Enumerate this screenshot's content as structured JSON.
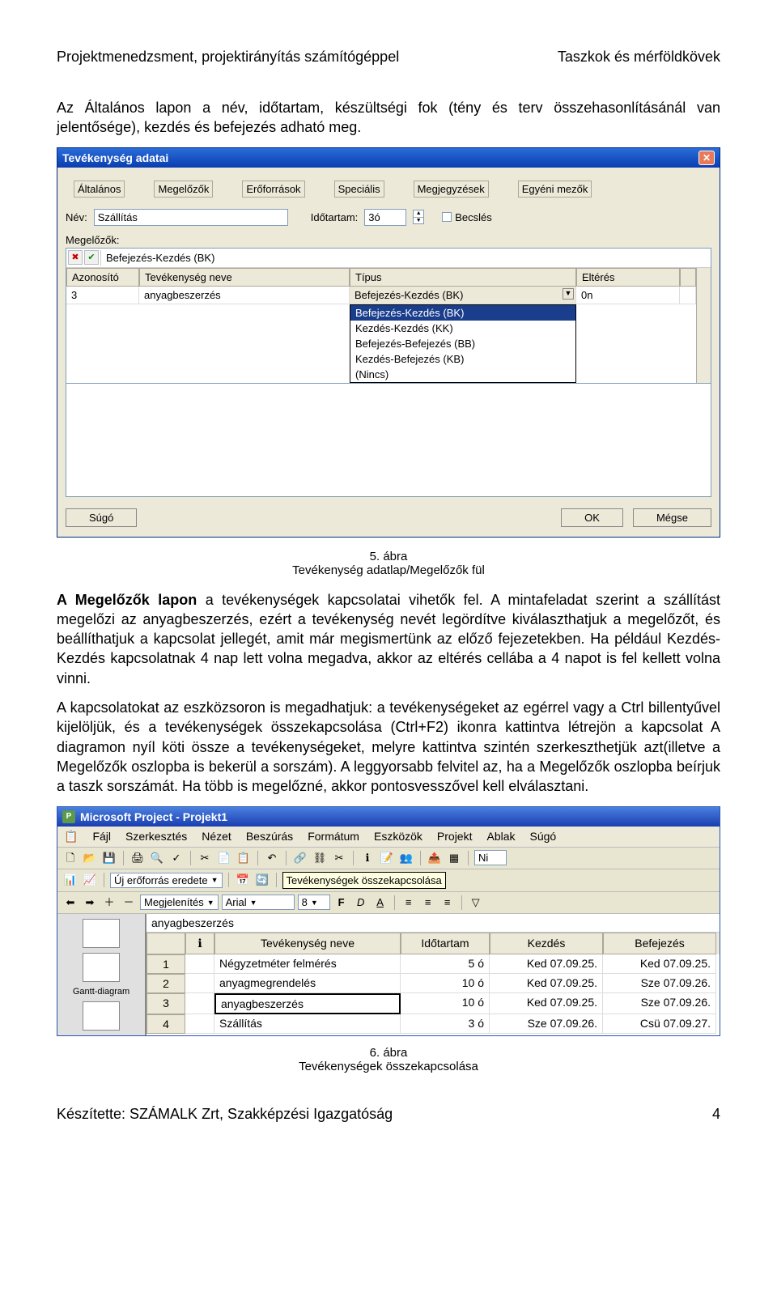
{
  "doc": {
    "header_left": "Projektmenedzsment, projektirányítás számítógéppel",
    "header_right": "Taszkok és mérföldkövek",
    "p1": "Az Általános lapon a név, időtartam, készültségi fok (tény és terv összehasonlításánál van jelentősége), kezdés és befejezés adható meg.",
    "fig5_caption_a": "5. ábra",
    "fig5_caption_b": "Tevékenység adatlap/Megelőzők fül",
    "p2": "A Megelőzők lapon a tevékenységek kapcsolatai vihetők fel. A mintafeladat szerint a szállítást megelőzi az anyagbeszerzés, ezért a tevékenység nevét legördítve kiválaszthatjuk a megelőzőt, és beállíthatjuk a kapcsolat jellegét, amit már megismertünk az előző fejezetekben. Ha például Kezdés-Kezdés kapcsolatnak 4 nap lett volna megadva, akkor az eltérés cellába a 4 napot is fel kellett volna vinni.",
    "p3": "A kapcsolatokat az eszközsoron is megadhatjuk: a tevékenységeket az egérrel vagy a Ctrl billentyűvel kijelöljük, és a tevékenységek összekapcsolása (Ctrl+F2) ikonra kattintva létrejön a kapcsolat A diagramon nyíl köti össze a tevékenységeket, melyre kattintva szintén szerkeszthetjük azt(illetve a Megelőzők oszlopba is bekerül a sorszám). A leggyorsabb felvitel az, ha a Megelőzők oszlopba beírjuk a taszk sorszámát. Ha több is megelőzné, akkor pontosvesszővel kell elválasztani.",
    "fig6_caption_a": "6. ábra",
    "fig6_caption_b": "Tevékenységek összekapcsolása",
    "footer_left": "Készítette: SZÁMALK Zrt, Szakképzési Igazgatóság",
    "footer_right": "4"
  },
  "dialog": {
    "title": "Tevékenység adatai",
    "tabs": [
      "Általános",
      "Megelőzők",
      "Erőforrások",
      "Speciális",
      "Megjegyzések",
      "Egyéni mezők"
    ],
    "lbl_name": "Név:",
    "name": "Szállítás",
    "lbl_dur": "Időtartam:",
    "dur": "3ó",
    "lbl_est": "Becslés",
    "lbl_pred": "Megelőzők:",
    "edit_value": "Befejezés-Kezdés (BK)",
    "headers": [
      "Azonosító",
      "Tevékenység neve",
      "Típus",
      "Eltérés"
    ],
    "row": {
      "id": "3",
      "name": "anyagbeszerzés",
      "type": "Befejezés-Kezdés (BK)",
      "lag": "0n"
    },
    "dd_options": [
      "Befejezés-Kezdés (BK)",
      "Kezdés-Kezdés (KK)",
      "Befejezés-Befejezés (BB)",
      "Kezdés-Befejezés (KB)",
      "(Nincs)"
    ],
    "btn_help": "Súgó",
    "btn_ok": "OK",
    "btn_cancel": "Mégse"
  },
  "app": {
    "title": "Microsoft Project - Projekt1",
    "menu": [
      "Fájl",
      "Szerkesztés",
      "Nézet",
      "Beszúrás",
      "Formátum",
      "Eszközök",
      "Projekt",
      "Ablak",
      "Súgó"
    ],
    "tb_newres": "Új erőforrás eredete",
    "tb_show": "Megjelenítés",
    "tb_font": "Arial",
    "tb_size": "8",
    "tooltip": "Tevékenységek összekapcsolása",
    "edit_value": "anyagbeszerzés",
    "side_label": "Gantt-diagram",
    "sheet_headers": [
      "",
      "",
      "Tevékenység neve",
      "Időtartam",
      "Kezdés",
      "Befejezés"
    ],
    "info_icon": "ℹ",
    "rows": [
      {
        "n": "1",
        "name": "Négyzetméter felmérés",
        "dur": "5 ó",
        "start": "Ked 07.09.25.",
        "end": "Ked 07.09.25."
      },
      {
        "n": "2",
        "name": "anyagmegrendelés",
        "dur": "10 ó",
        "start": "Ked 07.09.25.",
        "end": "Sze 07.09.26."
      },
      {
        "n": "3",
        "name": "anyagbeszerzés",
        "dur": "10 ó",
        "start": "Ked 07.09.25.",
        "end": "Sze 07.09.26."
      },
      {
        "n": "4",
        "name": "Szállítás",
        "dur": "3 ó",
        "start": "Sze 07.09.26.",
        "end": "Csü 07.09.27."
      }
    ],
    "ni": "Ni"
  }
}
